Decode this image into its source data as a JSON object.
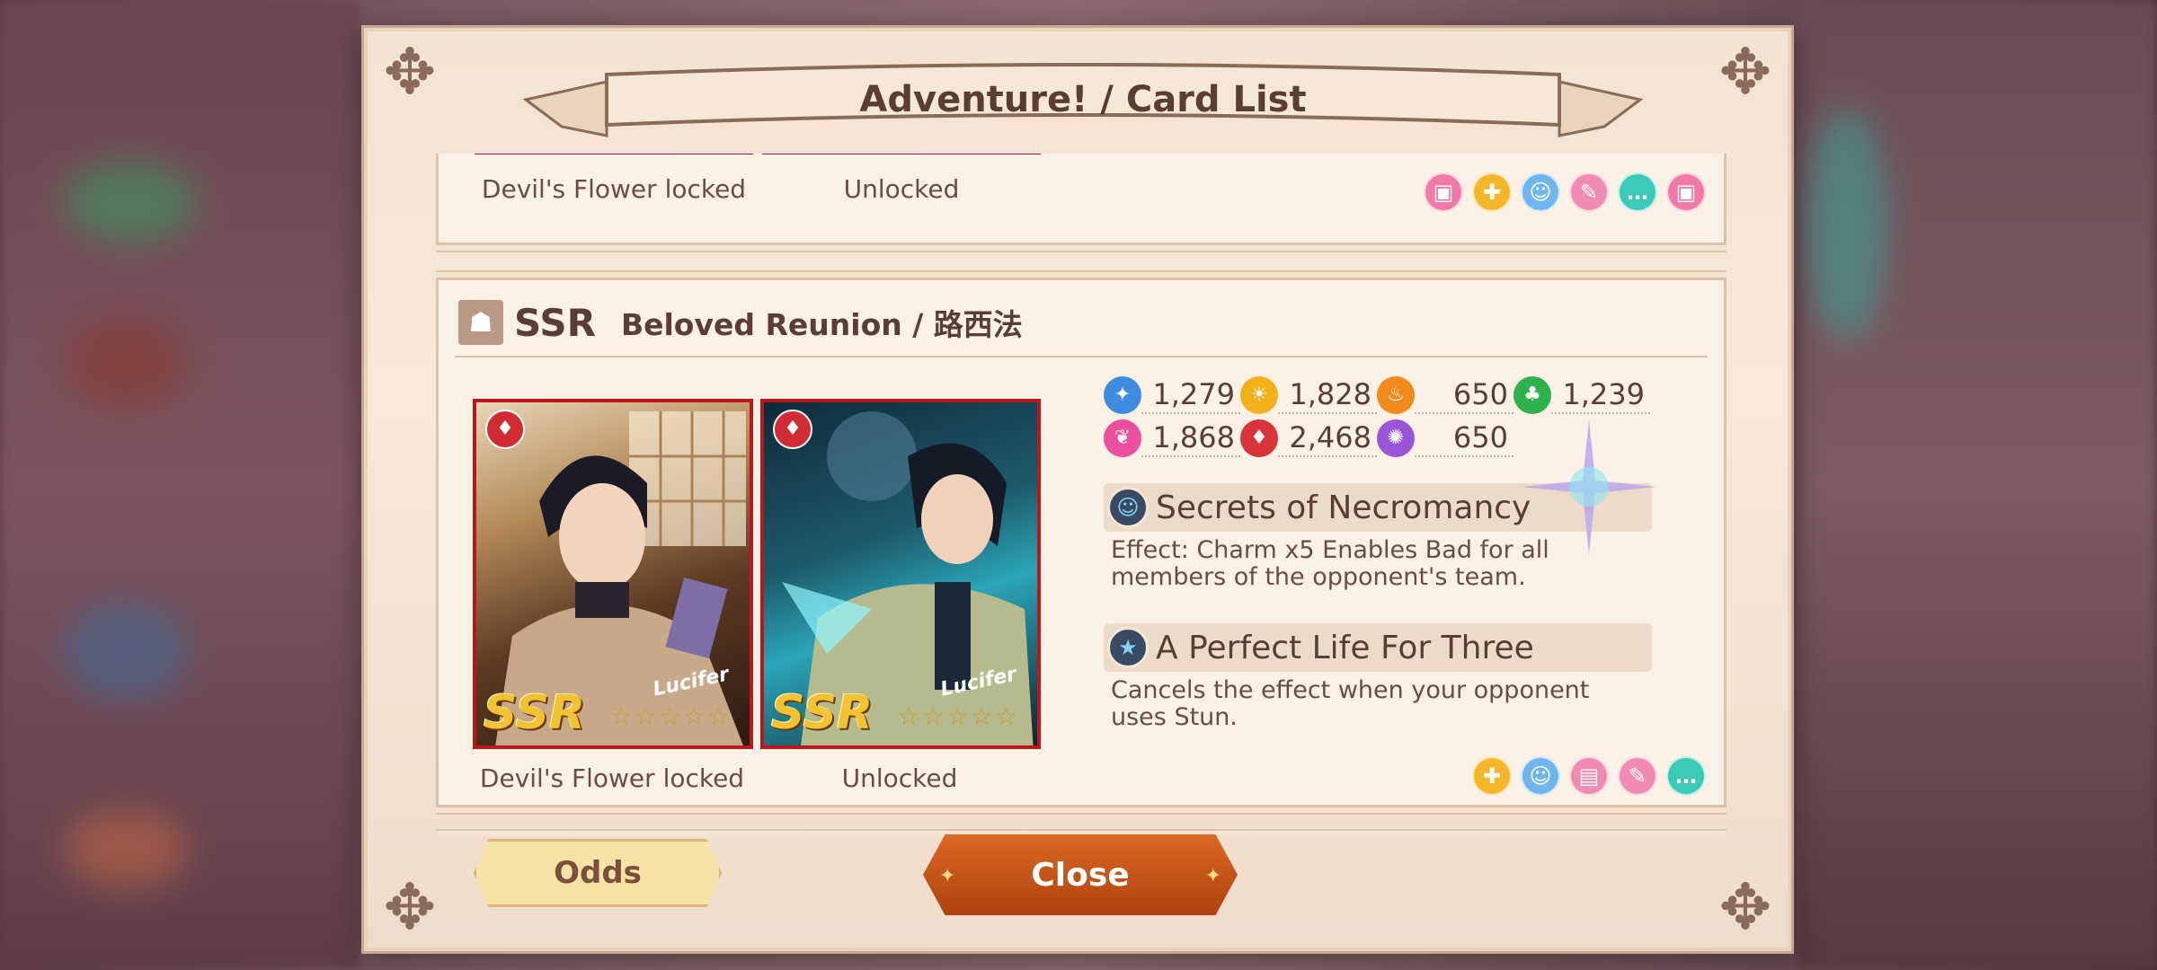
{
  "dialog": {
    "title": "Adventure! / Card List"
  },
  "previous_card": {
    "left_label": "Devil's Flower locked",
    "right_label": "Unlocked",
    "icons": [
      "camera-icon",
      "gift-icon",
      "face-icon",
      "mic-icon",
      "chat-icon",
      "camera-icon"
    ]
  },
  "card": {
    "rarity": "SSR",
    "title": "Beloved Reunion / 路西法",
    "character": "Lucifer",
    "left_image_label": "Devil's Flower locked",
    "right_image_label": "Unlocked",
    "stats": [
      {
        "icon": "blue-gem-icon",
        "color": "#3f8de0",
        "value": "1,279"
      },
      {
        "icon": "sun-icon",
        "color": "#f2b01b",
        "value": "1,828"
      },
      {
        "icon": "flame-icon",
        "color": "#f08a1c",
        "value": "650"
      },
      {
        "icon": "leaf-icon",
        "color": "#2fb24e",
        "value": "1,239"
      },
      {
        "icon": "heart-gem-icon",
        "color": "#ec4f9d",
        "value": "1,868"
      },
      {
        "icon": "red-gem-icon",
        "color": "#d9343a",
        "value": "2,468"
      },
      {
        "icon": "purple-gem-icon",
        "color": "#9b55d8",
        "value": "650"
      }
    ],
    "skills": [
      {
        "name": "Secrets of Necromancy",
        "icon": "face-skill-icon",
        "description": "Effect: Charm x5 Enables Bad for all members of the opponent's team."
      },
      {
        "name": "A Perfect Life For Three",
        "icon": "star-skill-icon",
        "description": "Cancels the effect when your opponent uses Stun."
      }
    ],
    "reward_icons": [
      "gift-icon",
      "face-icon",
      "image-icon",
      "mic-icon",
      "chat-icon"
    ]
  },
  "buttons": {
    "odds": "Odds",
    "close": "Close"
  },
  "colors": {
    "panel_bg": "#fbf1e4",
    "close_button": "#c4511a",
    "odds_button": "#f7e2a8",
    "text_brown": "#5a3e33"
  }
}
